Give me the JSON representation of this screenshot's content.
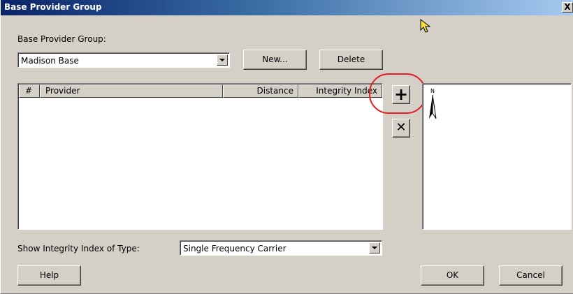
{
  "window": {
    "title": "Base Provider Group",
    "close_glyph": "X"
  },
  "group": {
    "label": "Base Provider Group:",
    "selected": "Madison Base",
    "new_label": "New...",
    "delete_label": "Delete"
  },
  "table": {
    "columns": [
      "#",
      "Provider",
      "Distance",
      "Integrity Index"
    ],
    "rows": []
  },
  "side_buttons": {
    "add_glyph": "+",
    "remove_glyph": "✕"
  },
  "map_preview": {
    "north_letter": "N"
  },
  "integrity": {
    "label": "Show Integrity Index of Type:",
    "selected": "Single Frequency Carrier"
  },
  "footer": {
    "help_label": "Help",
    "ok_label": "OK",
    "cancel_label": "Cancel"
  },
  "annotation": {
    "highlight_color": "#e31b23"
  },
  "colors": {
    "titlebar_start": "#0a246a",
    "titlebar_end": "#a6caf0",
    "face": "#d4d0c8"
  }
}
